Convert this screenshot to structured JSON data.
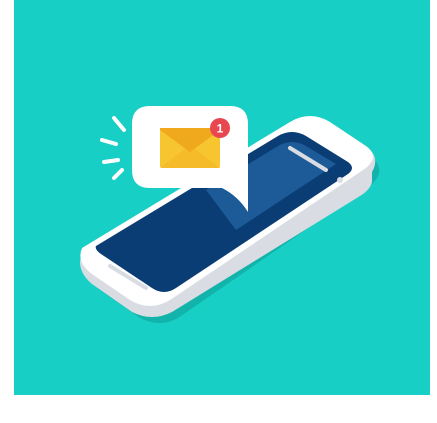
{
  "colors": {
    "background": "#17cfc5",
    "phone_body": "#ffffff",
    "phone_edge": "#d9dde3",
    "phone_shadow": "#12b3aa",
    "screen": "#0b3d75",
    "screen_highlight": "#1c5a98",
    "bubble": "#ffffff",
    "envelope": "#f7c530",
    "envelope_flap": "#f0a81d",
    "badge": "#e8474f",
    "motion_lines": "#ffffff"
  },
  "notification": {
    "icon": "envelope-icon",
    "badge_count": "1"
  }
}
